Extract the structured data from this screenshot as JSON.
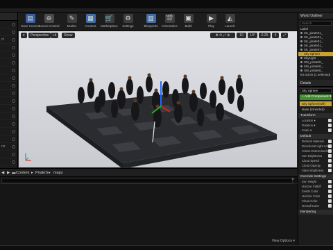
{
  "toolbar": {
    "items": [
      {
        "label": "Save Current",
        "icon": "save-icon",
        "glyph": "▤",
        "color": "#3a5fa0"
      },
      {
        "label": "Source Control",
        "icon": "source-control-icon",
        "glyph": "⊖",
        "color": "#4a4a4a"
      },
      {
        "label": "Modes",
        "icon": "modes-icon",
        "glyph": "✎",
        "color": "#3d3d3d"
      },
      {
        "label": "Content",
        "icon": "content-icon",
        "glyph": "▦",
        "color": "#3f6ea8"
      },
      {
        "label": "Marketplace",
        "icon": "marketplace-icon",
        "glyph": "🛒",
        "color": "#3d3d3d"
      },
      {
        "label": "Settings",
        "icon": "settings-icon",
        "glyph": "⚙",
        "color": "#3d3d3d"
      },
      {
        "label": "Blueprints",
        "icon": "blueprints-icon",
        "glyph": "▥",
        "color": "#3f6ea8"
      },
      {
        "label": "Cinematics",
        "icon": "cinematics-icon",
        "glyph": "🎬",
        "color": "#3d3d3d"
      },
      {
        "label": "Build",
        "icon": "build-icon",
        "glyph": "▣",
        "color": "#3d3d3d"
      },
      {
        "label": "Play",
        "icon": "play-icon",
        "glyph": "▶",
        "color": "#3d3d3d"
      },
      {
        "label": "Launch",
        "icon": "launch-icon",
        "glyph": "◭",
        "color": "#3d3d3d"
      }
    ]
  },
  "viewport": {
    "perspective_label": "Perspective",
    "lit_label": "Lit",
    "show_label": "Show",
    "grid_snap": "10",
    "rot_snap": "10°",
    "scale_snap": "0.25",
    "cam_speed": "4"
  },
  "left_panel": {
    "rows": [
      "",
      "",
      "ct",
      "",
      "",
      "",
      "",
      "",
      "",
      "",
      "",
      "",
      "",
      "",
      "",
      "",
      "ne",
      "",
      ""
    ]
  },
  "path_bar": {
    "content_label": "Content",
    "folder1": "PirateS",
    "folder2": "maps"
  },
  "content_browser": {
    "view_options": "View Options ▾"
  },
  "outliner": {
    "title": "World Outliner",
    "search_placeholder": "Search",
    "label_header": "Label",
    "rows": [
      "SK_pirate01_",
      "SK_pirate01_",
      "SK_pirate01_",
      "SK_pirate01_",
      "SK_pirate01_",
      "Sky Sphere",
      "SkyLight",
      "SM_pirate01_",
      "SM_pirate01_",
      "SM_pirate01_"
    ],
    "selected_index": 5,
    "actor_count": "84 actors (1 selected)"
  },
  "details": {
    "title": "Details",
    "name_value": "Sky Sphere",
    "add_component": "+ Add Component ▾",
    "component_root": "Sky Sphere(self)",
    "component_child": "Base (Inherited)",
    "transform_section": "Transform",
    "transform_rows": [
      "Location ▾",
      "Rotation ▾",
      "Scale ▾"
    ],
    "default_section": "Default",
    "default_rows": [
      "Refresh Material",
      "Directional Light Actor",
      "Colors Determined By",
      "Sun Brightness",
      "Cloud Speed",
      "Cloud Opacity",
      "Stars Brightness"
    ],
    "override_section": "Override Settings",
    "override_rows": [
      "Sun Height",
      "Horizon Falloff",
      "Zenith Color",
      "Horizon Color",
      "Cloud Color",
      "Overall Color"
    ],
    "rendering_section": "Rendering"
  },
  "colors": {
    "accent_selected": "#c8a233",
    "add_component_green": "#3f8d2c",
    "component_root_bg": "#c8a233"
  }
}
